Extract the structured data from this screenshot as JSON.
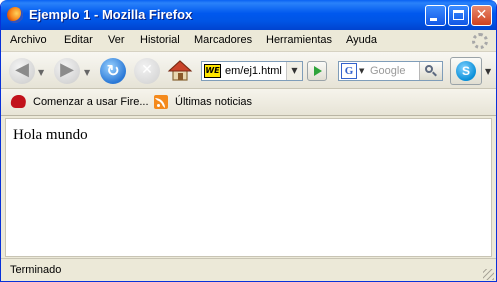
{
  "window": {
    "title": "Ejemplo 1 - Mozilla Firefox",
    "colors": {
      "titlebar": "#0055e5",
      "close_button": "#cf4120",
      "chrome": "#ece9d8"
    }
  },
  "menubar": {
    "items": [
      "Archivo",
      "Editar",
      "Ver",
      "Historial",
      "Marcadores",
      "Herramientas",
      "Ayuda"
    ]
  },
  "navbar": {
    "back_icon": "back-arrow-icon",
    "forward_icon": "forward-arrow-icon",
    "reload_icon": "reload-icon",
    "stop_icon": "stop-icon",
    "home_icon": "home-icon",
    "url_badge": "WE",
    "url_value": "em/ej1.html",
    "go_icon": "go-arrow-icon",
    "search_engine_icon": "G",
    "search_placeholder": "Google",
    "skype_icon": "S"
  },
  "bookmarks": {
    "items": [
      {
        "label": "Comenzar a usar Fire...",
        "icon": "mozilla-icon"
      },
      {
        "label": "Últimas noticias",
        "icon": "rss-icon"
      }
    ]
  },
  "page": {
    "content_text": "Hola mundo"
  },
  "statusbar": {
    "text": "Terminado"
  }
}
